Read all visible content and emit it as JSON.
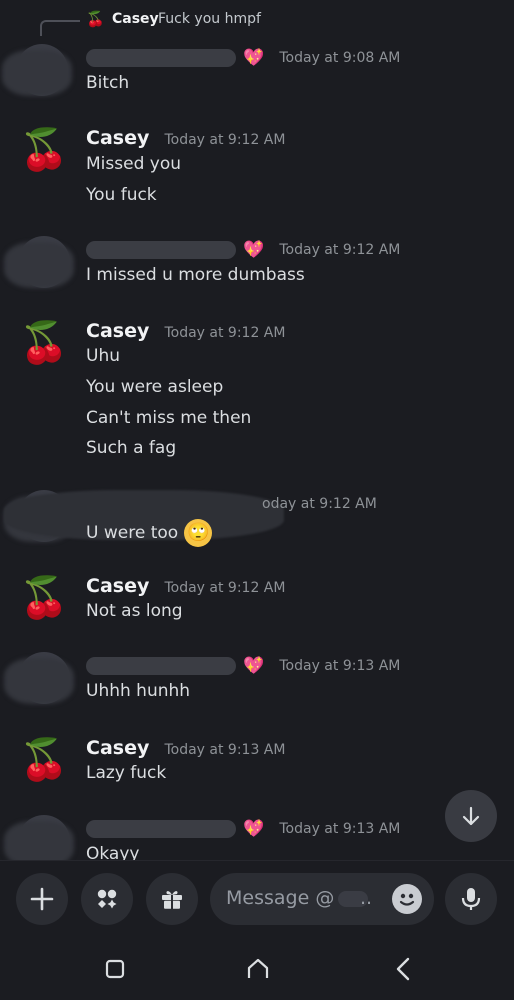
{
  "reply": {
    "author": "Casey",
    "text": "Fuck you hmpf",
    "avatar_emoji": "🍒"
  },
  "messages": [
    {
      "author": "",
      "redacted_author": true,
      "heart": "💖",
      "time": "Today at 9:08 AM",
      "lines": [
        "Bitch"
      ]
    },
    {
      "author": "Casey",
      "avatar_emoji": "🍒",
      "time": "Today at 9:12 AM",
      "lines": [
        "Missed you",
        "You fuck"
      ]
    },
    {
      "author": "",
      "redacted_author": true,
      "heart": "💖",
      "time": "Today at 9:12 AM",
      "lines": [
        "I missed u more dumbass"
      ]
    },
    {
      "author": "Casey",
      "avatar_emoji": "🍒",
      "time": "Today at 9:12 AM",
      "lines": [
        "Uhu",
        "You were asleep",
        "Can't miss me then",
        "Such a fag"
      ]
    },
    {
      "author": "",
      "redacted_author": true,
      "time": "oday at 9:12 AM",
      "lines": [
        "U were too"
      ],
      "emoji": "🙄"
    },
    {
      "author": "Casey",
      "avatar_emoji": "🍒",
      "time": "Today at 9:12 AM",
      "lines": [
        "Not as long"
      ]
    },
    {
      "author": "",
      "redacted_author": true,
      "heart": "💖",
      "time": "Today at 9:13 AM",
      "lines": [
        "Uhhh hunhh"
      ]
    },
    {
      "author": "Casey",
      "avatar_emoji": "🍒",
      "time": "Today at 9:13 AM",
      "lines": [
        "Lazy fuck"
      ]
    },
    {
      "author": "",
      "redacted_author": true,
      "heart": "💖",
      "time": "Today at 9:13 AM",
      "lines": [
        "Okayy"
      ]
    }
  ],
  "composer": {
    "placeholder": "Message @",
    "dots": ".."
  },
  "icons": {
    "jump": "arrow-down-icon",
    "add": "plus-icon",
    "apps": "apps-icon",
    "gift": "gift-icon",
    "emoji": "emoji-icon",
    "mic": "microphone-icon",
    "recents": "recents-icon",
    "home": "home-icon",
    "back": "back-icon"
  },
  "colors": {
    "background": "#1b1c21",
    "text": "#dbdee1",
    "muted": "#8e9297",
    "button": "#2b2d33"
  }
}
